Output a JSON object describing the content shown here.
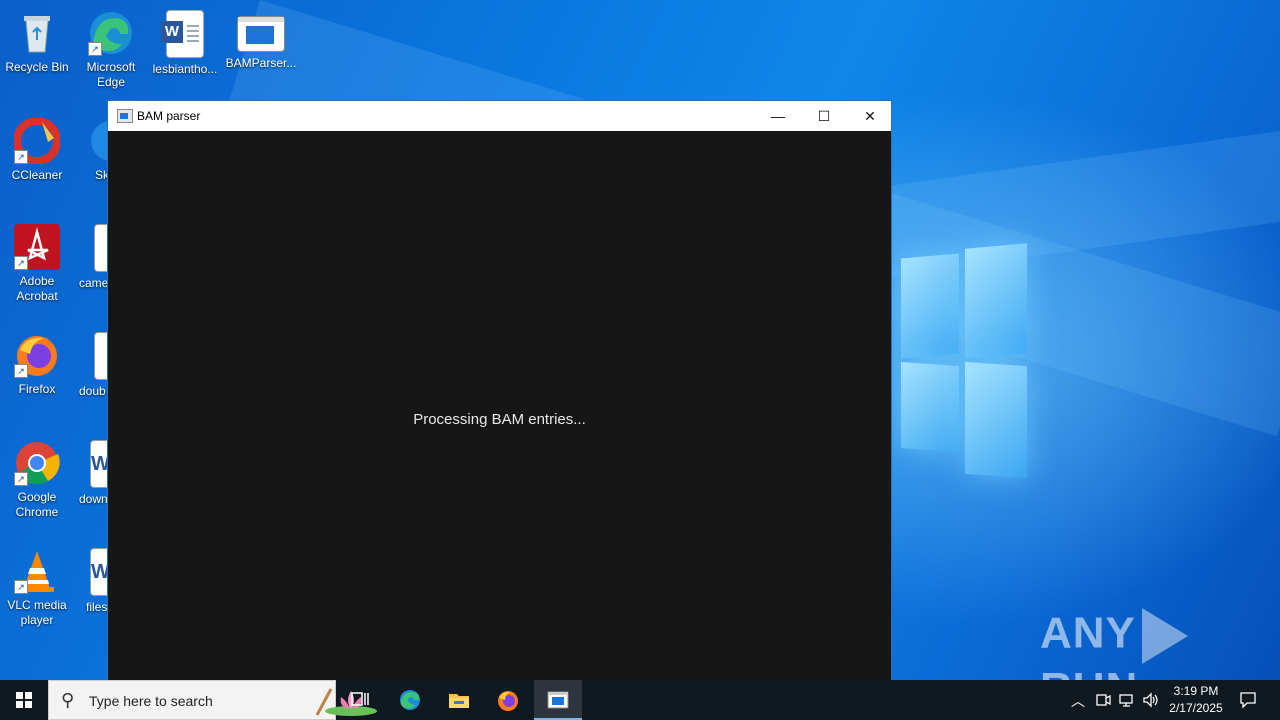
{
  "desktop": {
    "icons": [
      {
        "label": "Recycle Bin"
      },
      {
        "label": "Microsoft Edge"
      },
      {
        "label": "lesbiantho..."
      },
      {
        "label": "BAMParser..."
      },
      {
        "label": "CCleaner"
      },
      {
        "label": "Sk"
      },
      {
        "label": "Adobe Acrobat"
      },
      {
        "label": "came"
      },
      {
        "label": "Firefox"
      },
      {
        "label": "doub"
      },
      {
        "label": "Google Chrome"
      },
      {
        "label": "down"
      },
      {
        "label": "VLC media player"
      },
      {
        "label": "files"
      }
    ]
  },
  "window": {
    "title": "BAM parser",
    "minimize_glyph": "—",
    "maximize_glyph": "☐",
    "close_glyph": "✕",
    "status_text": "Processing BAM entries..."
  },
  "watermark": {
    "left": "ANY",
    "right": "RUN"
  },
  "taskbar": {
    "search_placeholder": "Type here to search",
    "apps": [
      "task-view",
      "microsoft-edge",
      "file-explorer",
      "firefox",
      "bam-parser"
    ],
    "time": "3:19 PM",
    "date": "2/17/2025"
  },
  "colors": {
    "taskbar": "#101820",
    "window_bg": "#161616",
    "accent": "#76b9ed"
  }
}
